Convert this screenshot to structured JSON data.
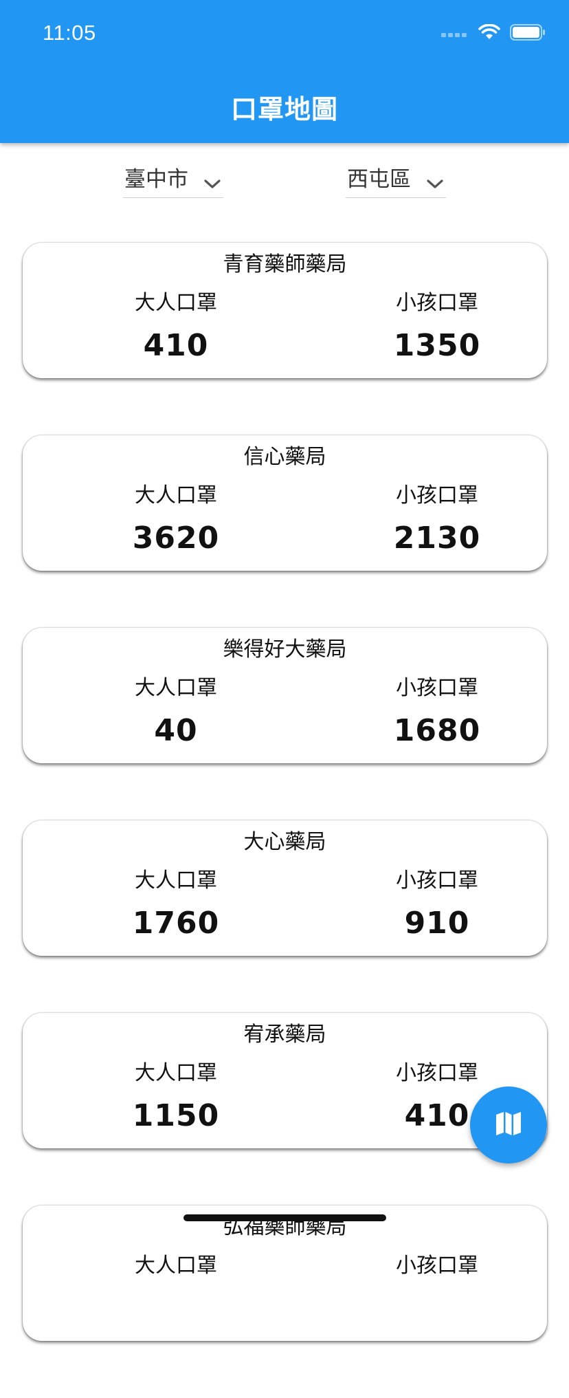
{
  "status_bar": {
    "time": "11:05",
    "icons": [
      "signal-icon",
      "wifi-icon",
      "battery-icon"
    ]
  },
  "app_bar": {
    "title": "口罩地圖",
    "color": "#2196f3"
  },
  "filters": {
    "city": {
      "value": "臺中市",
      "icon": "chevron-down-icon"
    },
    "district": {
      "value": "西屯區",
      "icon": "chevron-down-icon"
    }
  },
  "pharmacies": [
    {
      "name": "青育藥師藥局",
      "adult_label": "大人口罩",
      "adult_count": "410",
      "child_label": "小孩口罩",
      "child_count": "1350"
    },
    {
      "name": "信心藥局",
      "adult_label": "大人口罩",
      "adult_count": "3620",
      "child_label": "小孩口罩",
      "child_count": "2130"
    },
    {
      "name": "樂得好大藥局",
      "adult_label": "大人口罩",
      "adult_count": "40",
      "child_label": "小孩口罩",
      "child_count": "1680"
    },
    {
      "name": "大心藥局",
      "adult_label": "大人口罩",
      "adult_count": "1760",
      "child_label": "小孩口罩",
      "child_count": "910"
    },
    {
      "name": "宥承藥局",
      "adult_label": "大人口罩",
      "adult_count": "1150",
      "child_label": "小孩口罩",
      "child_count": "410"
    },
    {
      "name": "弘福藥師藥局",
      "adult_label": "大人口罩",
      "adult_count": "",
      "child_label": "小孩口罩",
      "child_count": ""
    }
  ],
  "fab": {
    "icon": "map-icon",
    "color": "#2196f3"
  }
}
